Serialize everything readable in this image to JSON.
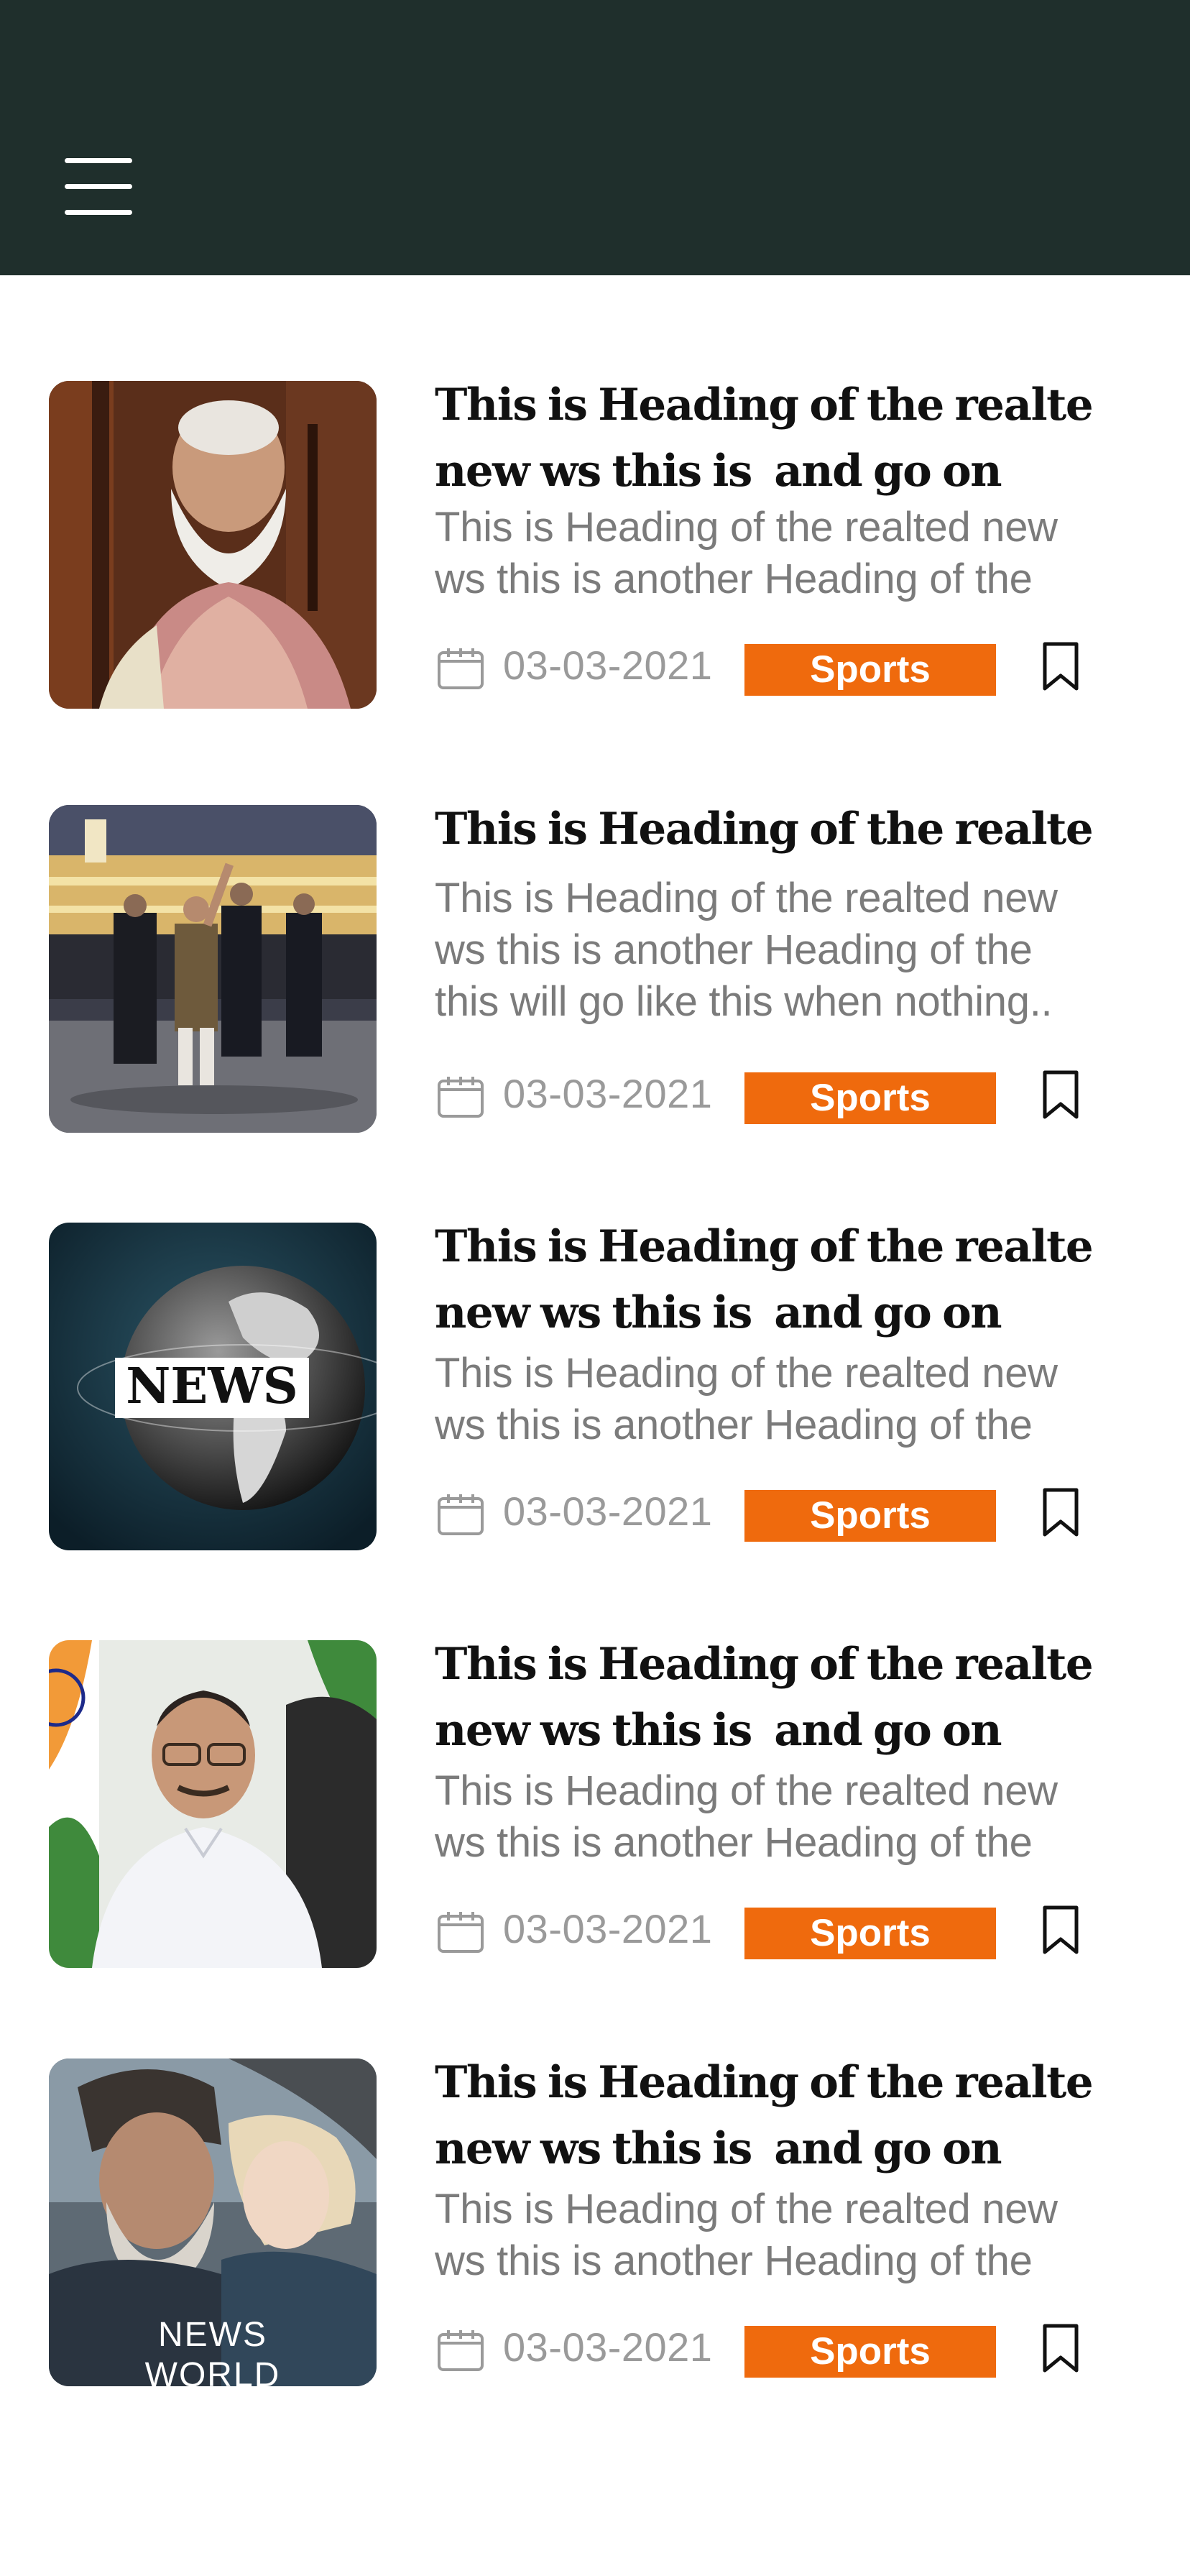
{
  "header": {
    "menu_icon": "hamburger-menu-icon",
    "background": "#1f2f2c"
  },
  "accent_color": "#ef6a0d",
  "articles": [
    {
      "title_line1": "This is Heading of the realte",
      "title_line2": "new ws this is  and go on",
      "excerpt_line1": "This is Heading of the realted new",
      "excerpt_line2": "ws this is another Heading of the",
      "excerpt_line3": "",
      "date": "03-03-2021",
      "category": "Sports",
      "image": "bearded-man-portrait"
    },
    {
      "title_line1": "This is Heading of the realte",
      "title_line2": "",
      "excerpt_line1": "This is Heading of the realted new",
      "excerpt_line2": "ws this is another Heading of the",
      "excerpt_line3": "this will go like this when nothing..",
      "date": "03-03-2021",
      "category": "Sports",
      "image": "man-waving-at-parade"
    },
    {
      "title_line1": "This is Heading of the realte",
      "title_line2": "new ws this is  and go on",
      "excerpt_line1": "This is Heading of the realted new",
      "excerpt_line2": "ws this is another Heading of the",
      "excerpt_line3": "",
      "date": "03-03-2021",
      "category": "Sports",
      "image": "news-globe",
      "image_text": "NEWS"
    },
    {
      "title_line1": "This is Heading of the realte",
      "title_line2": "new ws this is  and go on",
      "excerpt_line1": "This is Heading of the realted new",
      "excerpt_line2": "ws this is another Heading of the",
      "excerpt_line3": "",
      "date": "03-03-2021",
      "category": "Sports",
      "image": "man-at-desk-with-flag"
    },
    {
      "title_line1": "This is Heading of the realte",
      "title_line2": "new ws this is  and go on",
      "excerpt_line1": "This is Heading of the realted new",
      "excerpt_line2": "ws this is another Heading of the",
      "excerpt_line3": "",
      "date": "03-03-2021",
      "category": "Sports",
      "image": "news-of-the-world-poster",
      "image_text_top": "NEWS",
      "image_text_bottom": "WORLD"
    }
  ]
}
